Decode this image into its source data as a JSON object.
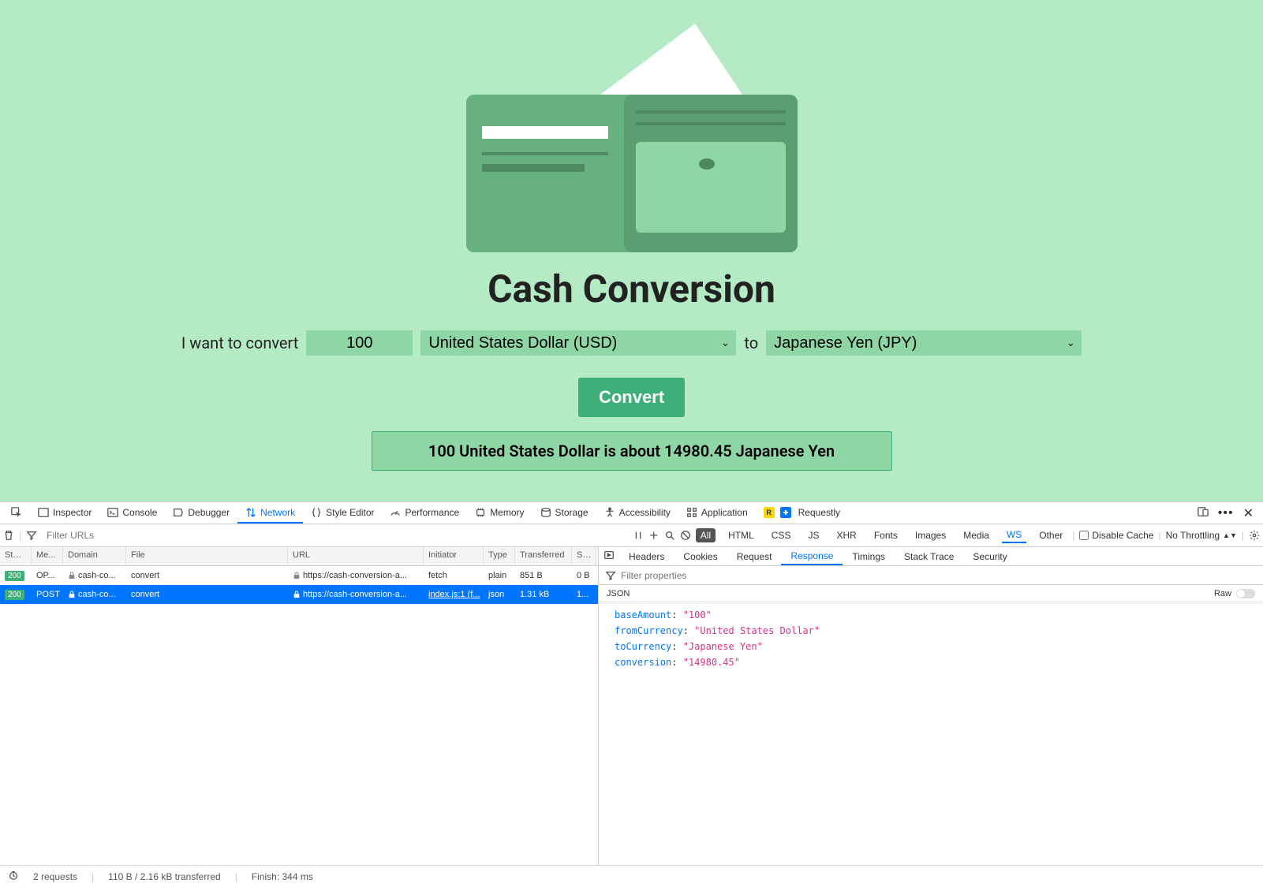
{
  "app": {
    "title": "Cash Conversion",
    "label_intro": "I want to convert",
    "amount": "100",
    "from_currency": "United States Dollar (USD)",
    "label_to": "to",
    "to_currency": "Japanese Yen (JPY)",
    "convert_button": "Convert",
    "result": "100 United States Dollar is about 14980.45 Japanese Yen"
  },
  "devtools": {
    "tabs": [
      "Inspector",
      "Console",
      "Debugger",
      "Network",
      "Style Editor",
      "Performance",
      "Memory",
      "Storage",
      "Accessibility",
      "Application",
      "Requestly"
    ],
    "active_tab": "Network",
    "filter_placeholder": "Filter URLs",
    "filter_tabs": [
      "All",
      "HTML",
      "CSS",
      "JS",
      "XHR",
      "Fonts",
      "Images",
      "Media",
      "WS",
      "Other"
    ],
    "filter_active": "All",
    "disable_cache_label": "Disable Cache",
    "throttling_label": "No Throttling",
    "columns": [
      "Stat...",
      "Me...",
      "Domain",
      "File",
      "URL",
      "Initiator",
      "Type",
      "Transferred",
      "Si..."
    ],
    "rows": [
      {
        "status": "200",
        "method": "OP...",
        "domain": "cash-co...",
        "file": "convert",
        "url": "https://cash-conversion-a...",
        "initiator": "fetch",
        "type": "plain",
        "transferred": "851 B",
        "size": "0 B",
        "selected": false
      },
      {
        "status": "200",
        "method": "POST",
        "domain": "cash-co...",
        "file": "convert",
        "url": "https://cash-conversion-a...",
        "initiator": "index.js:1 (f...",
        "type": "json",
        "transferred": "1.31 kB",
        "size": "1...",
        "selected": true
      }
    ],
    "detail_tabs": [
      "Headers",
      "Cookies",
      "Request",
      "Response",
      "Timings",
      "Stack Trace",
      "Security"
    ],
    "detail_active": "Response",
    "detail_filter_placeholder": "Filter properties",
    "json_label": "JSON",
    "raw_label": "Raw",
    "json_response": [
      {
        "key": "baseAmount",
        "value": "\"100\""
      },
      {
        "key": "fromCurrency",
        "value": "\"United States Dollar\""
      },
      {
        "key": "toCurrency",
        "value": "\"Japanese Yen\""
      },
      {
        "key": "conversion",
        "value": "\"14980.45\""
      }
    ],
    "status_bar": {
      "requests": "2 requests",
      "transferred": "110 B / 2.16 kB transferred",
      "finish": "Finish: 344 ms"
    }
  }
}
